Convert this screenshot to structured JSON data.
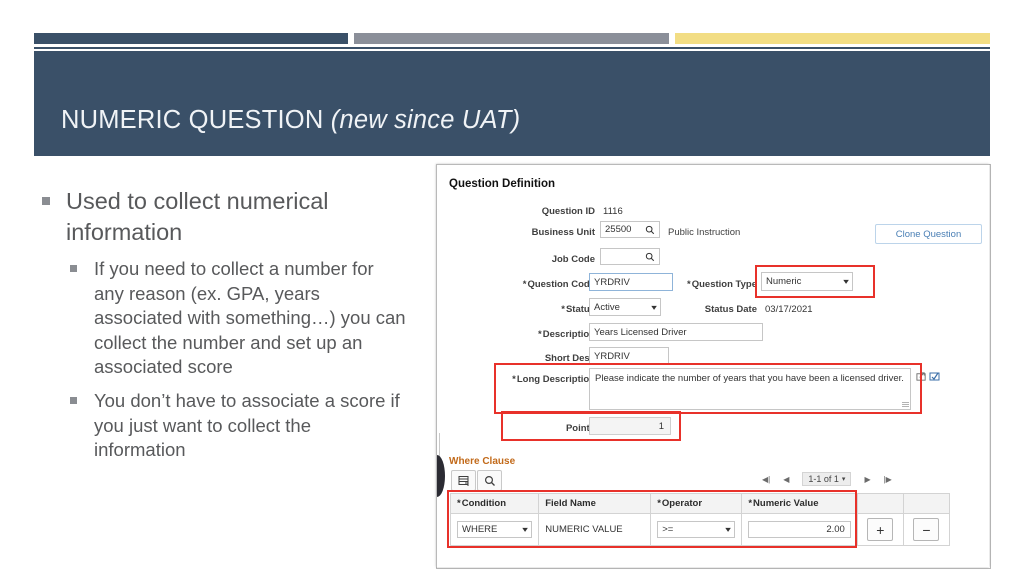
{
  "slide": {
    "title_main": "NUMERIC QUESTION ",
    "title_italic": "(new since UAT)",
    "accent_navy": "#3a5068",
    "accent_gray": "#8b8f99",
    "accent_gold": "#f2dd84",
    "highlight_red": "#e8312a"
  },
  "bullets": {
    "level1": "Used to collect numerical information",
    "level2": [
      "If you need to collect a number for any reason (ex. GPA, years associated with something…) you can collect the number and set up an associated score",
      "You don’t have to associate a score if you just want to collect the information"
    ]
  },
  "form": {
    "section_title": "Question Definition",
    "clone_button": "Clone Question",
    "fields": {
      "question_id_label": "Question ID",
      "question_id_value": "1116",
      "business_unit_label": "Business Unit",
      "business_unit_value": "25500",
      "business_unit_desc": "Public Instruction",
      "job_code_label": "Job Code",
      "job_code_value": "",
      "question_code_label": "Question Code",
      "question_code_value": "YRDRIV",
      "question_type_label": "Question Type",
      "question_type_value": "Numeric",
      "status_label": "Status",
      "status_value": "Active",
      "status_date_label": "Status Date",
      "status_date_value": "03/17/2021",
      "description_label": "Description",
      "description_value": "Years Licensed Driver",
      "short_desc_label": "Short Desc",
      "short_desc_value": "YRDRIV",
      "long_description_label": "Long Description",
      "long_description_value": "Please indicate the number of years that you have been a licensed driver.",
      "points_label": "Points",
      "points_value": "1"
    },
    "where_clause": {
      "section_label": "Where Clause",
      "pager_text": "1-1 of 1",
      "nav_first": "◀|",
      "nav_prev": "◀",
      "nav_next": "▶",
      "nav_last": "|▶",
      "columns": [
        "Condition",
        "Field Name",
        "Operator",
        "Numeric Value"
      ],
      "rows": [
        {
          "condition": "WHERE",
          "field_name": "NUMERIC VALUE",
          "operator": ">=",
          "numeric_value": "2.00",
          "add_label": "+",
          "remove_label": "−"
        }
      ]
    },
    "icons": {
      "lookup": "magnifier-icon",
      "personalize": "grid-personalize-icon",
      "find": "magnifier-icon",
      "expand": "expand-text-icon",
      "spellcheck": "spellcheck-icon"
    }
  }
}
